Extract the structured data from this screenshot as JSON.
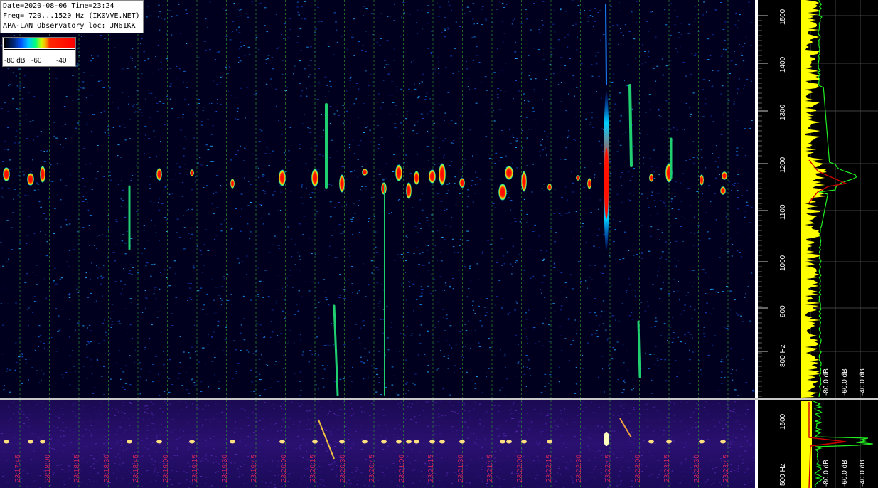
{
  "info": {
    "line1": "Date=2020-08-06 Time=23:24",
    "line2": "Freq= 720...1520 Hz (IK0VVE.NET)",
    "line3": "APA-LAN Observatory loc: JN61KK"
  },
  "legend": {
    "labels": [
      "-80 dB",
      "-60",
      "-40"
    ]
  },
  "top_freq_axis": {
    "ticks": [
      "1500",
      "1400",
      "1300",
      "1200",
      "1100",
      "1000",
      "900",
      "800 Hz"
    ]
  },
  "top_db_axis": {
    "ticks": [
      "-80.0 dB",
      "-60.0 dB",
      "-40.0 dB"
    ]
  },
  "bottom_freq_axis": {
    "ticks": [
      "1500",
      "500 Hz"
    ]
  },
  "bottom_db_axis": {
    "ticks": [
      "-80.0 dB",
      "-60.0 dB",
      "-40.0 dB"
    ]
  },
  "time_axis": {
    "labels": [
      "23:17:45",
      "23:18:00",
      "23:18:15",
      "23:18:30",
      "23:18:45",
      "23:19:00",
      "23:19:15",
      "23:19:30",
      "23:19:45",
      "23:20:00",
      "23:20:15",
      "23:20:30",
      "23:20:45",
      "23:21:00",
      "23:21:15",
      "23:21:30",
      "23:21:45",
      "23:22:00",
      "23:22:15",
      "23:22:30",
      "23:22:45",
      "23:23:00",
      "23:23:15",
      "23:23:30",
      "23:23:45"
    ]
  },
  "colors": {
    "background": "#00001e",
    "grid_green": "#2f8f2f",
    "time_label": "#d0245a",
    "spectrum_yellow": "#ffff00",
    "spectrum_green": "#22ee22",
    "spectrum_red": "#cc0000"
  }
}
